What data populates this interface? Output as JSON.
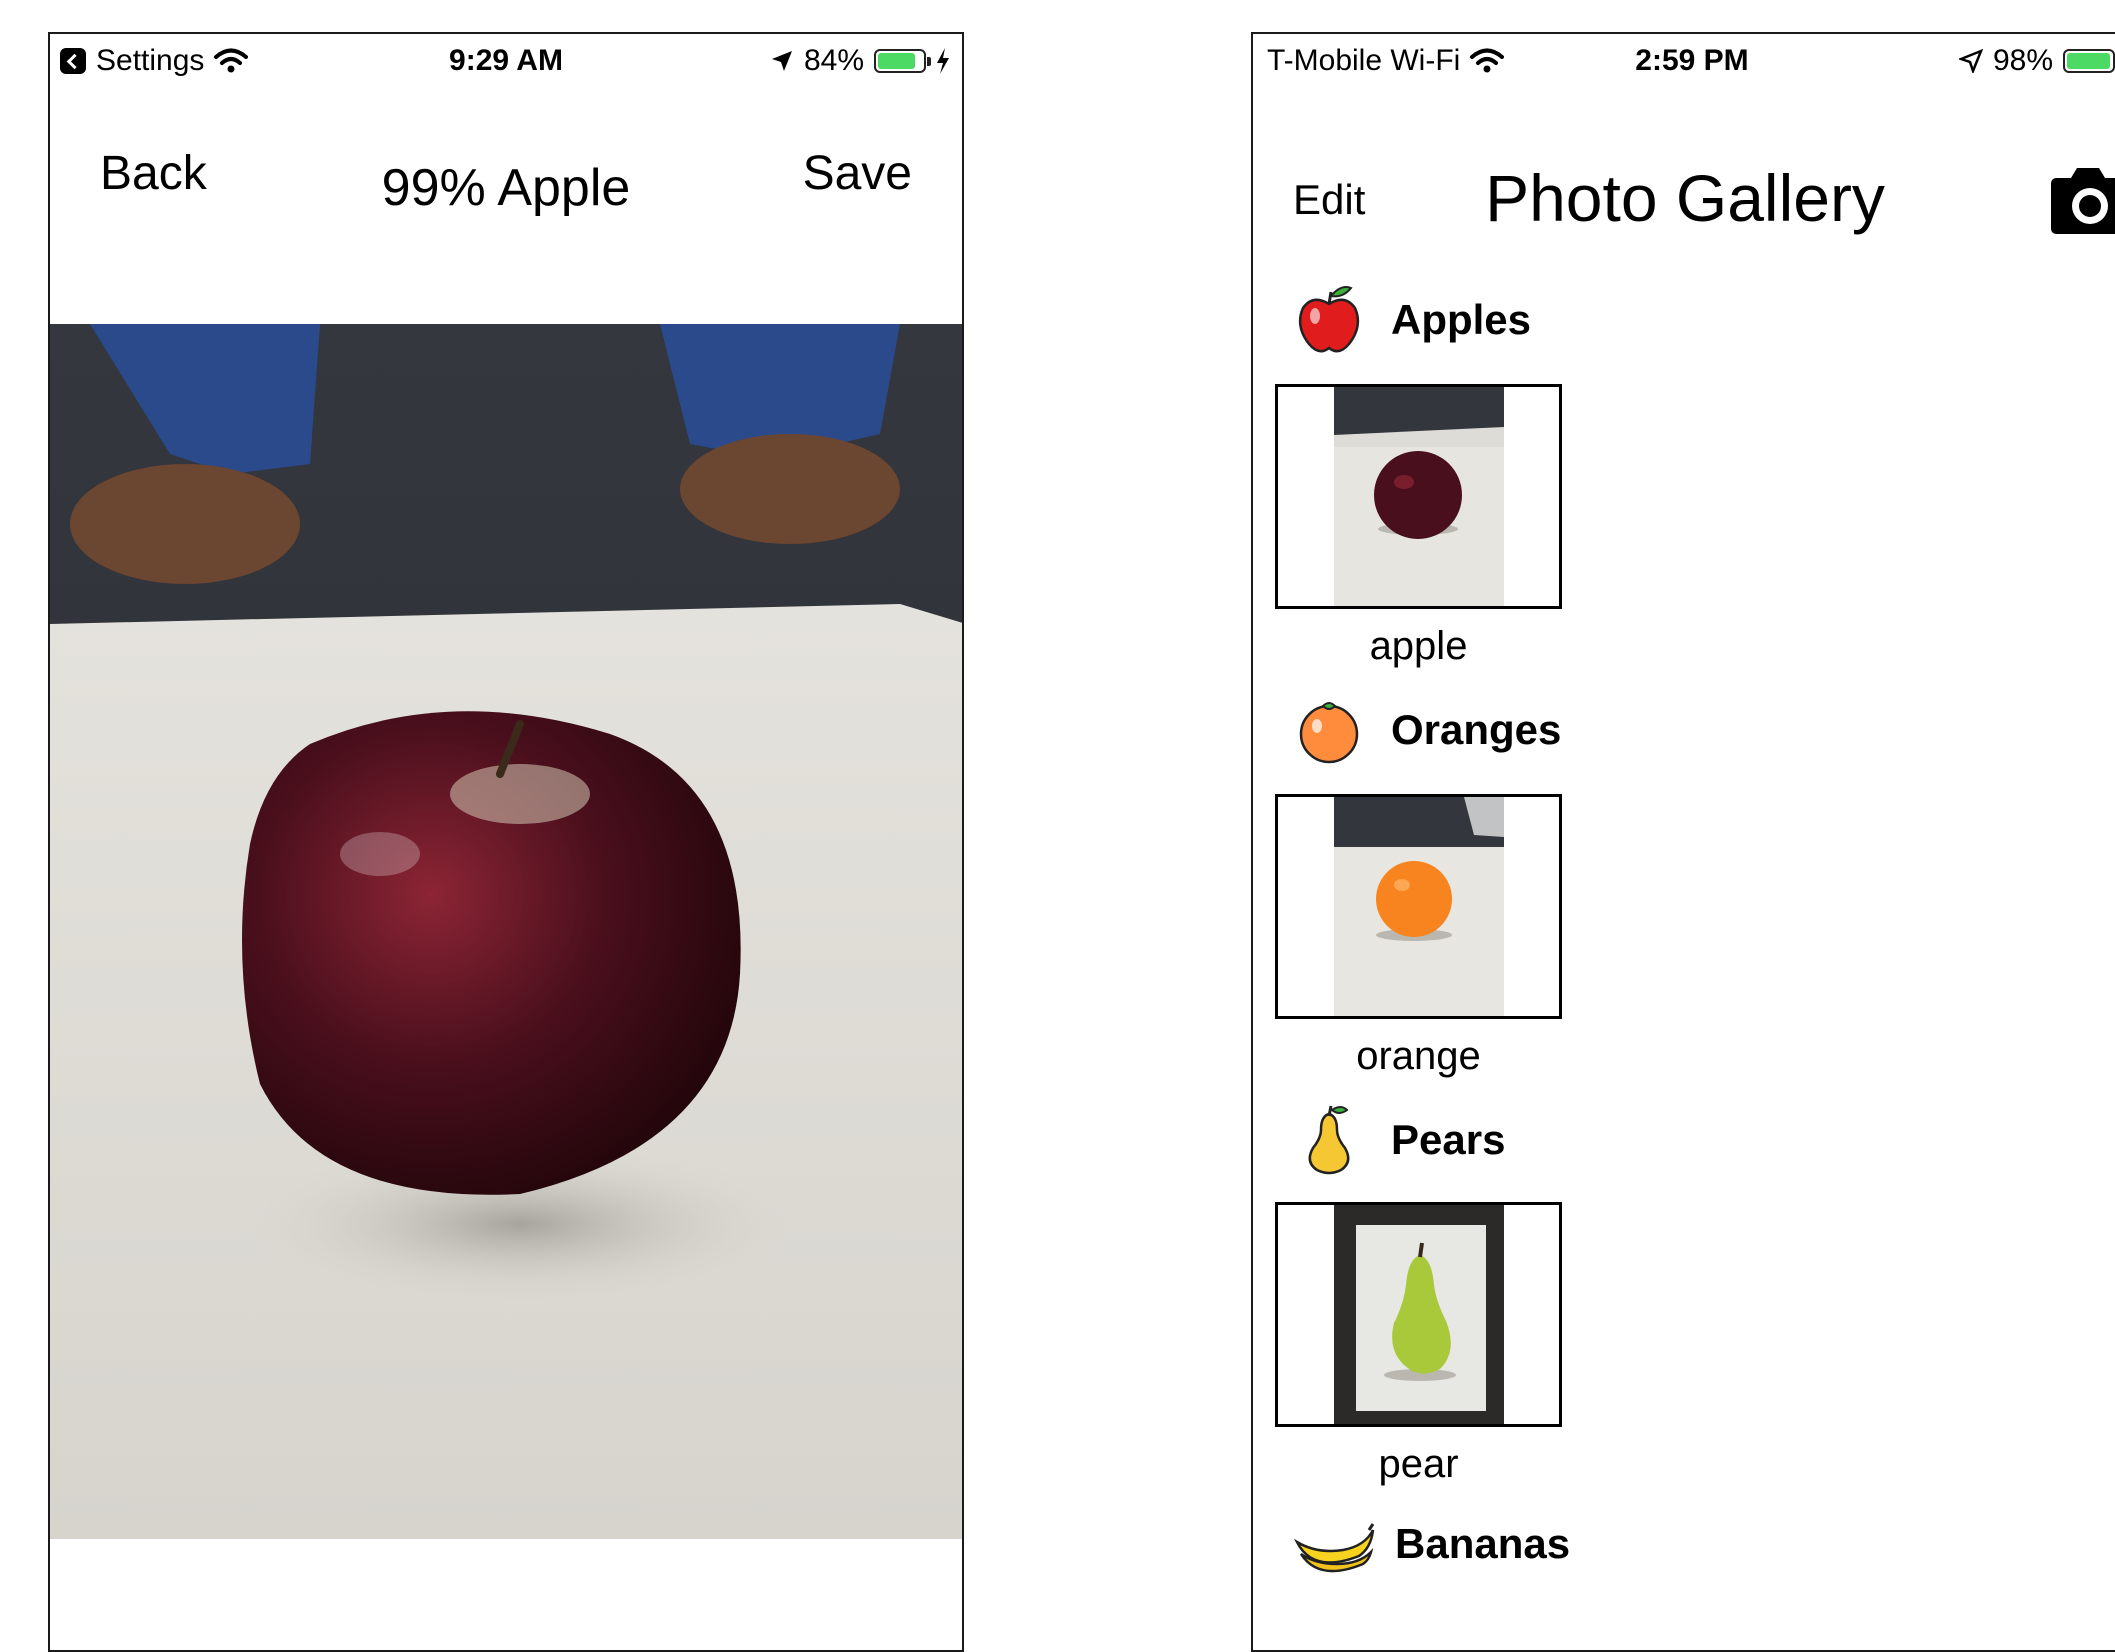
{
  "left_screen": {
    "status": {
      "back_app": "Settings",
      "time": "9:29 AM",
      "battery": "84%",
      "battery_level": 0.84
    },
    "nav": {
      "back_label": "Back",
      "title": "99% Apple",
      "save_label": "Save"
    }
  },
  "right_screen": {
    "status": {
      "carrier": "T-Mobile Wi-Fi",
      "time": "2:59 PM",
      "battery": "98%",
      "battery_level": 0.98
    },
    "nav": {
      "edit_label": "Edit",
      "title": "Photo Gallery"
    },
    "sections": [
      {
        "name": "Apples",
        "icon": "apple-icon",
        "photo_caption": "apple"
      },
      {
        "name": "Oranges",
        "icon": "orange-icon",
        "photo_caption": "orange"
      },
      {
        "name": "Pears",
        "icon": "pear-icon",
        "photo_caption": "pear"
      },
      {
        "name": "Bananas",
        "icon": "banana-icon"
      }
    ]
  },
  "colors": {
    "battery_fill": "#4cd964",
    "text": "#000000"
  }
}
